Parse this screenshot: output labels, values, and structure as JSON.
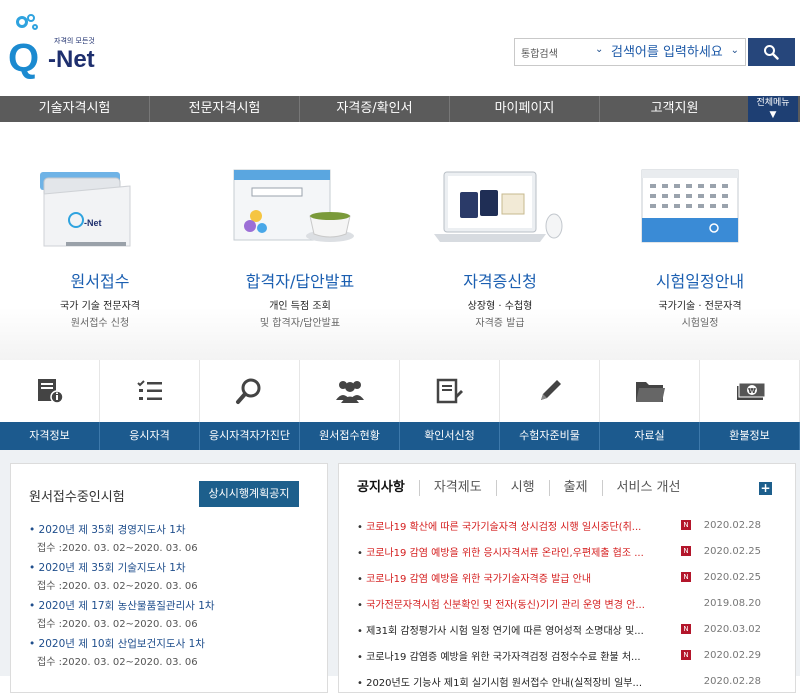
{
  "logo": {
    "letter": "Q",
    "name": "-Net",
    "tagline": "자격의 모든것"
  },
  "search": {
    "scope": "통합검색",
    "placeholder": "검색어를 입력하세요"
  },
  "nav": {
    "items": [
      "기술자격시험",
      "전문자격시험",
      "자격증/확인서",
      "마이페이지",
      "고객지원"
    ],
    "all_menu": "전체메뉴"
  },
  "services": [
    {
      "title": "원서접수",
      "sub1": "국가 기술 전문자격",
      "sub2": "원서접수 신청"
    },
    {
      "title": "합격자/답안발표",
      "sub1": "개인 득점 조회",
      "sub2": "및 합격자/답안발표"
    },
    {
      "title": "자격증신청",
      "sub1": "상장형 · 수첩형",
      "sub2": "자격증 발급"
    },
    {
      "title": "시험일정안내",
      "sub1": "국가기술 · 전문자격",
      "sub2": "시험일정"
    }
  ],
  "quick_menu": [
    {
      "label": "자격정보",
      "icon": "info-book-icon"
    },
    {
      "label": "응시자격",
      "icon": "checklist-icon"
    },
    {
      "label": "응시자격자가진단",
      "icon": "magnifier-icon"
    },
    {
      "label": "원서접수현황",
      "icon": "people-icon"
    },
    {
      "label": "확인서신청",
      "icon": "document-icon"
    },
    {
      "label": "수험자준비물",
      "icon": "pencil-icon"
    },
    {
      "label": "자료실",
      "icon": "folder-icon"
    },
    {
      "label": "환불정보",
      "icon": "money-icon"
    }
  ],
  "ongoing": {
    "title": "원서접수중인시험",
    "button": "상시시행계획공지",
    "items": [
      {
        "title": "2020년 제 35회 경영지도사 1차",
        "date": "접수 :2020. 03. 02~2020. 03. 06"
      },
      {
        "title": "2020년 제 35회 기술지도사 1차",
        "date": "접수 :2020. 03. 02~2020. 03. 06"
      },
      {
        "title": "2020년 제 17회 농산물품질관리사 1차",
        "date": "접수 :2020. 03. 02~2020. 03. 06"
      },
      {
        "title": "2020년 제 10회 산업보건지도사 1차",
        "date": "접수 :2020. 03. 02~2020. 03. 06"
      }
    ]
  },
  "notices": {
    "tabs": [
      "공지사항",
      "자격제도",
      "시행",
      "출제",
      "서비스 개선"
    ],
    "badge": "N",
    "items": [
      {
        "title": "코로나19 확산에 따른 국가기술자격 상시검정 시행 일시중단(취...",
        "date": "2020.02.28",
        "color": "red",
        "new": true
      },
      {
        "title": "코로나19 감염 예방을 위한 응시자격서류 온라인,우편제출 협조 ...",
        "date": "2020.02.25",
        "color": "red",
        "new": true
      },
      {
        "title": "코로나19 감염 예방을 위한 국가기술자격증 발급 안내",
        "date": "2020.02.25",
        "color": "red",
        "new": true
      },
      {
        "title": "국가전문자격시험 신분확인 및 전자(동신)기기 관리 운영 변경 안...",
        "date": "2019.08.20",
        "color": "red",
        "new": false
      },
      {
        "title": "제31회 감정평가사 시험 일정 연기에 따른 영어성적 소명대상 및...",
        "date": "2020.03.02",
        "color": "dark",
        "new": true
      },
      {
        "title": "코로나19 감염증 예방을 위한 국가자격검정 검정수수료 환불 처...",
        "date": "2020.02.29",
        "color": "dark",
        "new": true
      },
      {
        "title": "2020년도 기능사 제1회 실기시험 원서접수 안내(실적장비 일부...",
        "date": "2020.02.28",
        "color": "dark",
        "new": false
      }
    ]
  },
  "colors": {
    "nav_bg": "#5b5b5b",
    "accent_blue": "#1c5a8e",
    "notice_red": "#d41c1c",
    "search_btn": "#26467b"
  }
}
